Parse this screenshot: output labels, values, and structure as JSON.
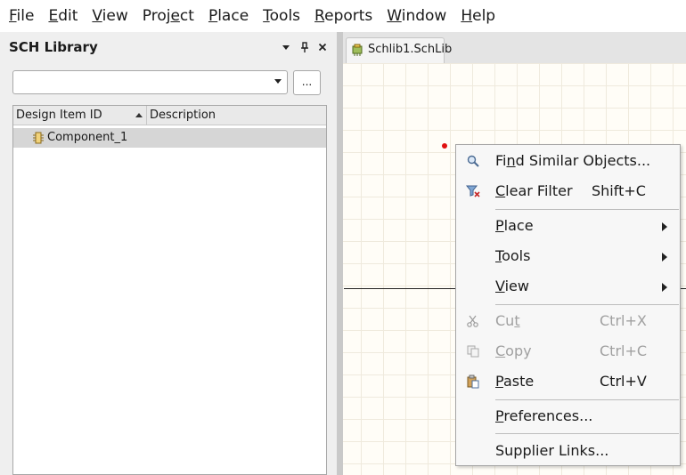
{
  "menubar": {
    "items": [
      {
        "text": "File",
        "ul_index": 0
      },
      {
        "text": "Edit",
        "ul_index": 0
      },
      {
        "text": "View",
        "ul_index": 0
      },
      {
        "text": "Project",
        "ul_index": 4
      },
      {
        "text": "Place",
        "ul_index": 0
      },
      {
        "text": "Tools",
        "ul_index": 0
      },
      {
        "text": "Reports",
        "ul_index": 0
      },
      {
        "text": "Window",
        "ul_index": 0
      },
      {
        "text": "Help",
        "ul_index": 0
      }
    ]
  },
  "panel": {
    "title": "SCH Library",
    "filter_value": "",
    "browse_label": "...",
    "columns": [
      "Design Item ID",
      "Description"
    ],
    "rows": [
      {
        "id": "Component_1",
        "description": ""
      }
    ]
  },
  "tab": {
    "label": "Schlib1.SchLib"
  },
  "context_menu": {
    "items": [
      {
        "label": "Find Similar Objects...",
        "ul_index": 2,
        "shortcut": "",
        "icon": "magnifier-icon",
        "enabled": true,
        "submenu": false
      },
      {
        "label": "Clear Filter",
        "ul_index": 0,
        "shortcut": "Shift+C",
        "icon": "clear-filter-icon",
        "enabled": true,
        "submenu": false
      },
      {
        "label": "Place",
        "ul_index": 0,
        "shortcut": "",
        "icon": "",
        "enabled": true,
        "submenu": true
      },
      {
        "label": "Tools",
        "ul_index": 0,
        "shortcut": "",
        "icon": "",
        "enabled": true,
        "submenu": true
      },
      {
        "label": "View",
        "ul_index": 0,
        "shortcut": "",
        "icon": "",
        "enabled": true,
        "submenu": true
      },
      {
        "label": "Cut",
        "ul_index": 2,
        "shortcut": "Ctrl+X",
        "icon": "scissors-icon",
        "enabled": false,
        "submenu": false
      },
      {
        "label": "Copy",
        "ul_index": 0,
        "shortcut": "Ctrl+C",
        "icon": "copy-icon",
        "enabled": false,
        "submenu": false
      },
      {
        "label": "Paste",
        "ul_index": 0,
        "shortcut": "Ctrl+V",
        "icon": "paste-icon",
        "enabled": true,
        "submenu": false
      },
      {
        "label": "Preferences...",
        "ul_index": 0,
        "shortcut": "",
        "icon": "",
        "enabled": true,
        "submenu": false
      },
      {
        "label": "Supplier Links...",
        "ul_index": -1,
        "shortcut": "",
        "icon": "",
        "enabled": true,
        "submenu": false
      }
    ]
  },
  "colors": {
    "accent_red": "#e01010",
    "canvas_bg": "#fffdf7",
    "grid_line": "#efeadd"
  }
}
